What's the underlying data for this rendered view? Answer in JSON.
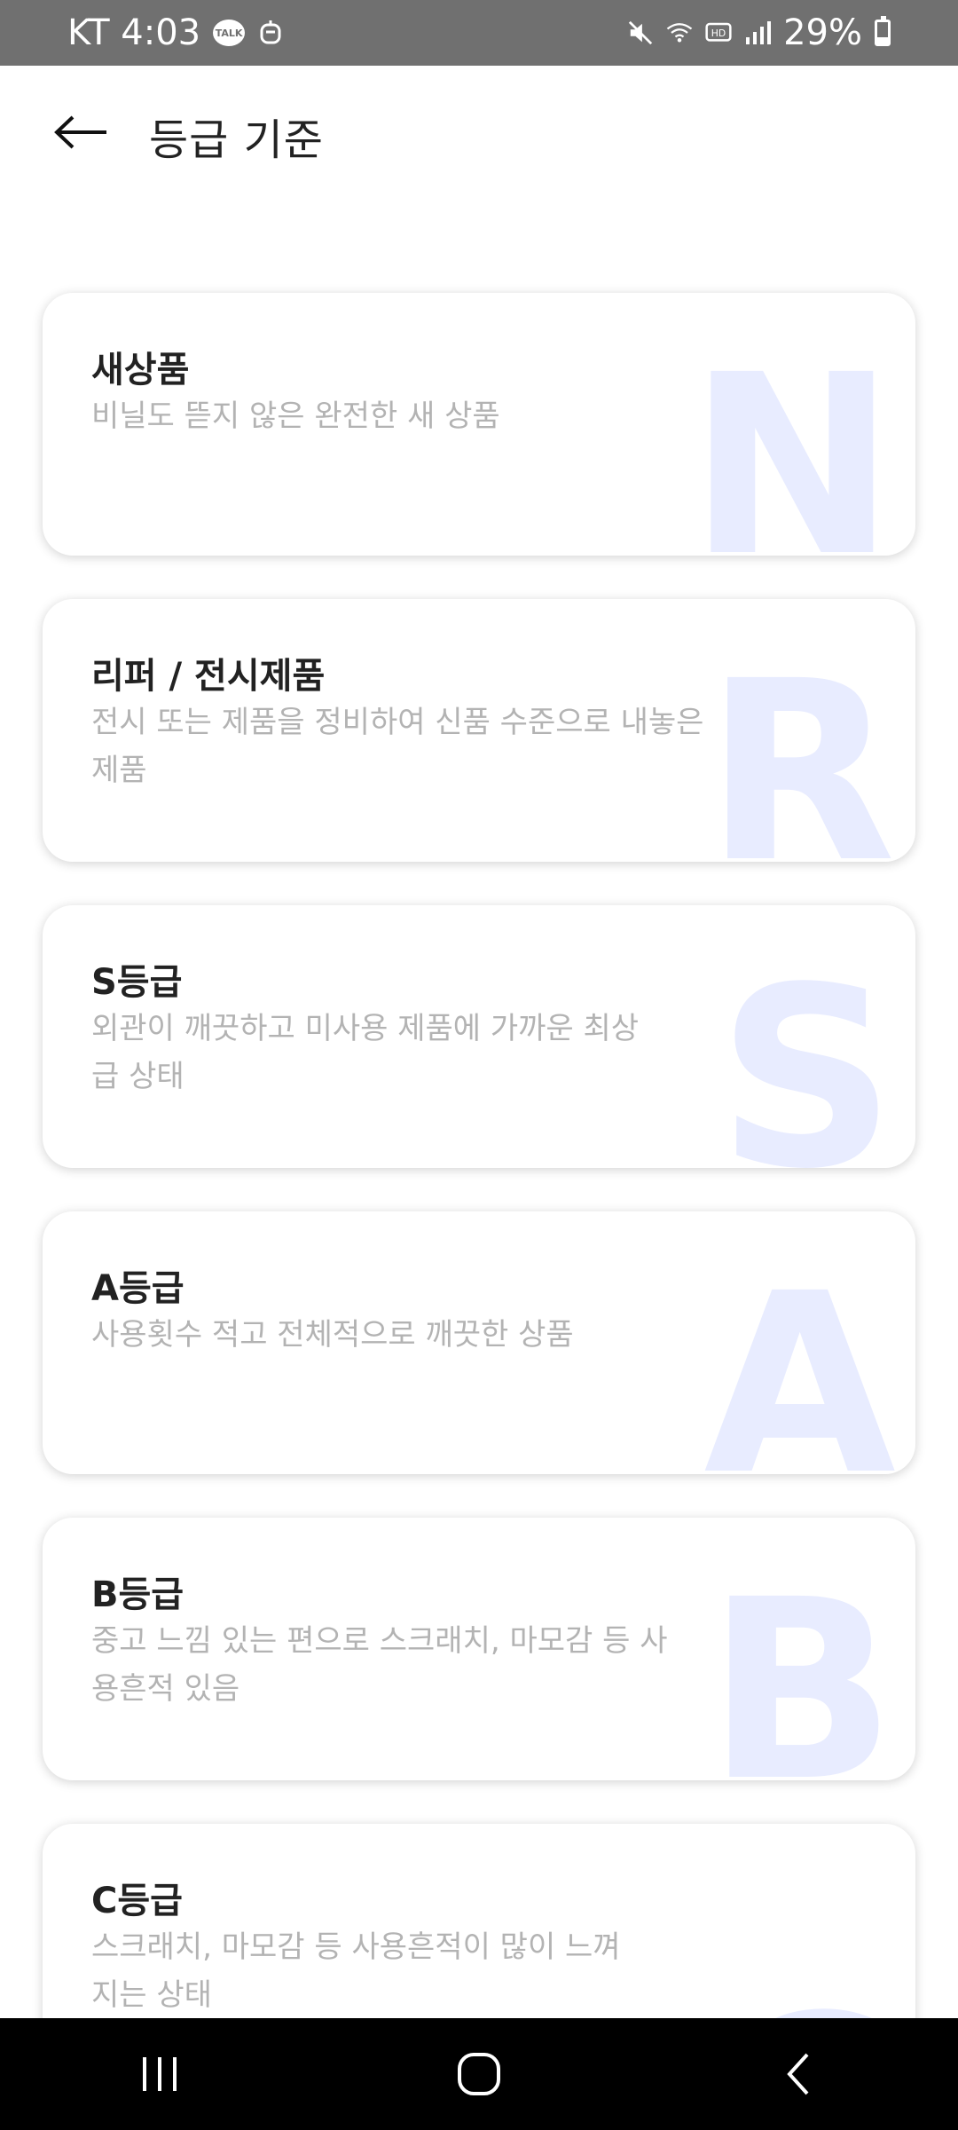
{
  "status_bar": {
    "carrier_time": "KT 4:03",
    "talk_label": "TALK",
    "battery": "29%"
  },
  "header": {
    "title": "등급 기준"
  },
  "grades": [
    {
      "letter": "N",
      "title": "새상품",
      "description": "비닐도 뜯지 않은 완전한 새 상품"
    },
    {
      "letter": "R",
      "title": "리퍼 / 전시제품",
      "description": "전시 또는 제품을 정비하여 신품 수준으로 내놓은 제품"
    },
    {
      "letter": "S",
      "title": "S등급",
      "description": "외관이 깨끗하고 미사용 제품에 가까운 최상급 상태"
    },
    {
      "letter": "A",
      "title": "A등급",
      "description": "사용횟수 적고 전체적으로 깨끗한 상품"
    },
    {
      "letter": "B",
      "title": "B등급",
      "description": "중고 느낌 있는 편으로 스크래치, 마모감 등 사용흔적 있음"
    },
    {
      "letter": "C",
      "title": "C등급",
      "description": "스크래치, 마모감 등 사용흔적이 많이 느껴지는 상태"
    }
  ],
  "icons": {
    "back": "arrow-left-icon",
    "recents": "recents-icon",
    "home": "home-icon",
    "nav_back": "chevron-left-icon"
  },
  "colors": {
    "status_bar": "#707070",
    "letter_watermark": "#e8ecff",
    "description_text": "#b3b3b3"
  }
}
